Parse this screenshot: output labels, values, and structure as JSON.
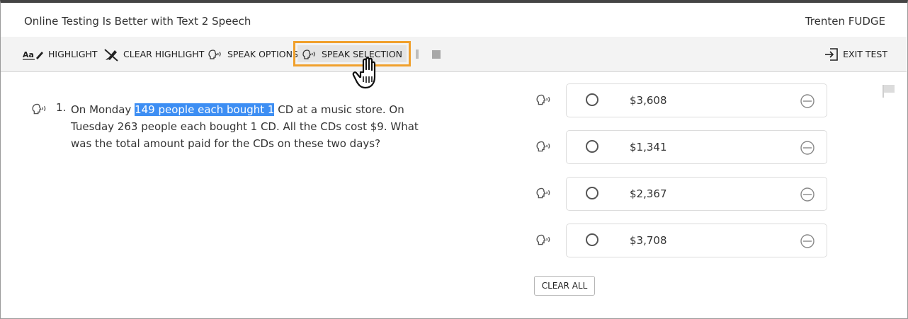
{
  "header": {
    "title": "Online Testing Is Better with Text 2 Speech",
    "user": "Trenten FUDGE"
  },
  "toolbar": {
    "highlight_label": "HIGHLIGHT",
    "clear_highlight_label": "CLEAR HIGHLIGHT",
    "speak_options_label": "SPEAK OPTIONS",
    "speak_selection_label": "SPEAK SELECTION",
    "exit_label": "EXIT TEST",
    "highlight_icon_text": "Aa",
    "focus_color": "#f0a02c"
  },
  "question": {
    "number": "1.",
    "text_before": "On Monday ",
    "text_highlighted": "149 people each bought 1",
    "text_after": " CD at a music store.  On Tuesday 263 people each bought 1 CD. All the CDs cost $9. What was the total amount paid for the CDs on these two days?",
    "highlight_color": "#3d8ef3"
  },
  "options": [
    {
      "label": "$3,608"
    },
    {
      "label": "$1,341"
    },
    {
      "label": "$2,367"
    },
    {
      "label": "$3,708"
    }
  ],
  "clear_all_label": "CLEAR ALL"
}
